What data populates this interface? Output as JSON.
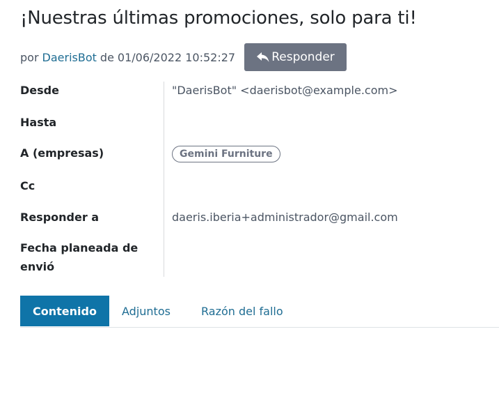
{
  "message": {
    "title": "¡Nuestras últimas promociones, solo para ti!",
    "by_label": "por",
    "author": "DaerisBot",
    "date_prefix": "de",
    "date": "01/06/2022 10:52:27",
    "reply_label": "Responder"
  },
  "fields": {
    "from_label": "Desde",
    "from_value": "\"DaerisBot\" <daerisbot@example.com>",
    "to_label": "Hasta",
    "companies_label": "A (empresas)",
    "companies_tag": "Gemini Furniture",
    "cc_label": "Cc",
    "reply_to_label": "Responder a",
    "reply_to_value": "daeris.iberia+administrador@gmail.com",
    "scheduled_label": "Fecha planeada de envió"
  },
  "tabs": [
    {
      "label": "Contenido",
      "active": true
    },
    {
      "label": "Adjuntos",
      "active": false
    },
    {
      "label": "Razón del fallo",
      "active": false
    }
  ],
  "colors": {
    "accent": "#0f74a8",
    "link": "#1f6d93",
    "button_gray": "#6c7382"
  },
  "icons": {
    "reply": "reply-arrow-icon"
  }
}
